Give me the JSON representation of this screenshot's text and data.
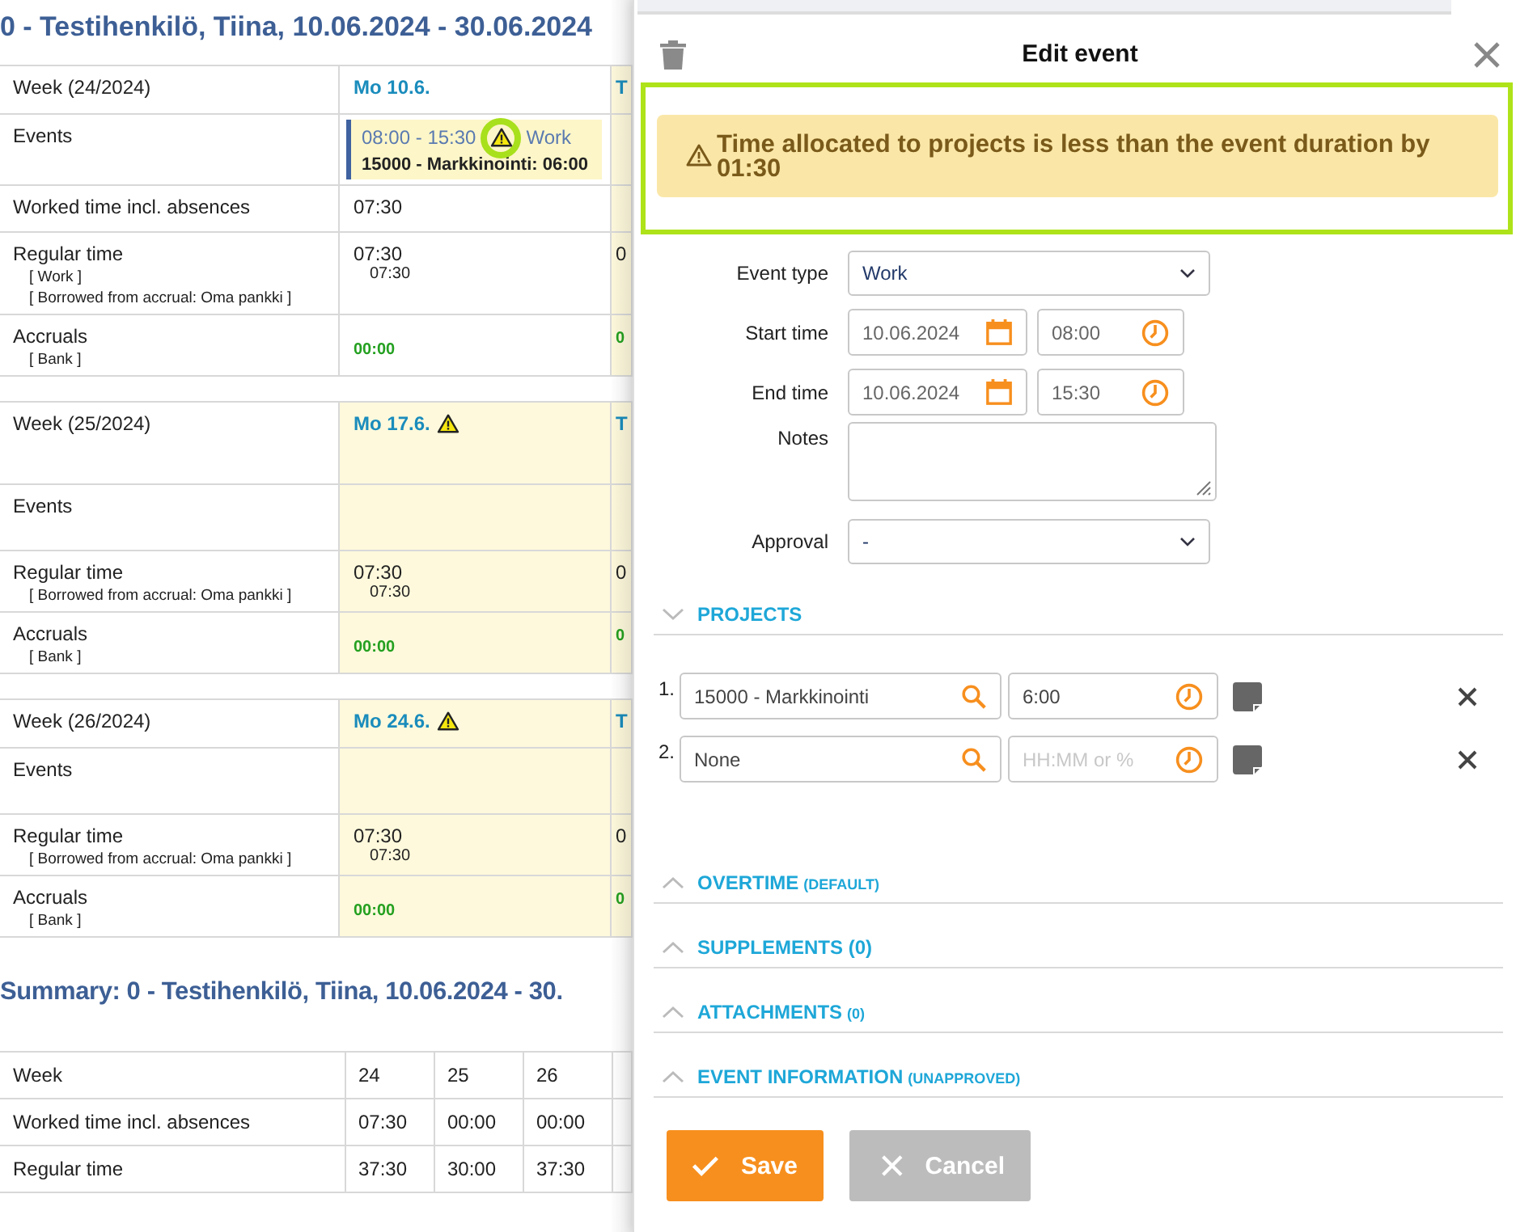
{
  "report_title": "0 - Testihenkilö, Tiina, 10.06.2024 - 30.06.2024",
  "weeks": [
    {
      "week_label": "Week",
      "week_number": "(24/2024)",
      "day": {
        "label": "Mo 10.6.",
        "warning": false,
        "highlighted": false
      },
      "next_day": {
        "label": "T",
        "highlighted": true
      },
      "rows": [
        {
          "kind": "events",
          "label": "Events",
          "event": {
            "time": "08:00 - 15:30",
            "type": "Work",
            "project": "15000 - Markkinointi: 06:00",
            "warning": true,
            "marked": true
          }
        },
        {
          "kind": "time",
          "label": "Worked time incl. absences",
          "value": "07:30"
        },
        {
          "kind": "time",
          "label": "Regular time",
          "details": [
            "[ Work ]",
            "[ Borrowed from accrual: Oma pankki ]"
          ],
          "value": "07:30",
          "sub_value": "07:30",
          "next_value": "0"
        },
        {
          "kind": "accrual",
          "label": "Accruals",
          "details": [
            "[ Bank ]"
          ],
          "value": "00:00",
          "next_value": "0"
        }
      ]
    },
    {
      "week_label": "Week",
      "week_number": "(25/2024)",
      "day": {
        "label": "Mo 17.6.",
        "warning": true,
        "highlighted": true
      },
      "next_day": {
        "label": "T",
        "highlighted": true
      },
      "rows": [
        {
          "kind": "events",
          "label": "Events"
        },
        {
          "kind": "time",
          "label": "Regular time",
          "details": [
            "[ Borrowed from accrual: Oma pankki ]"
          ],
          "value": "07:30",
          "sub_value": "07:30",
          "next_value": "0"
        },
        {
          "kind": "accrual",
          "label": "Accruals",
          "details": [
            "[ Bank ]"
          ],
          "value": "00:00",
          "next_value": "0"
        }
      ]
    },
    {
      "week_label": "Week",
      "week_number": "(26/2024)",
      "day": {
        "label": "Mo 24.6.",
        "warning": true,
        "highlighted": true
      },
      "next_day": {
        "label": "T",
        "highlighted": true
      },
      "rows": [
        {
          "kind": "events",
          "label": "Events"
        },
        {
          "kind": "time",
          "label": "Regular time",
          "details": [
            "[ Borrowed from accrual: Oma pankki ]"
          ],
          "value": "07:30",
          "sub_value": "07:30",
          "next_value": "0"
        },
        {
          "kind": "accrual",
          "label": "Accruals",
          "details": [
            "[ Bank ]"
          ],
          "value": "00:00",
          "next_value": "0"
        }
      ]
    }
  ],
  "summary": {
    "title": "Summary: 0 - Testihenkilö, Tiina, 10.06.2024 - 30.",
    "rows": [
      [
        "Week",
        "24",
        "25",
        "26"
      ],
      [
        "Worked time incl. absences",
        "07:30",
        "00:00",
        "00:00"
      ],
      [
        "Regular time",
        "37:30",
        "30:00",
        "37:30"
      ]
    ]
  },
  "dialog": {
    "title": "Edit event",
    "alert": {
      "text": "Time allocated to projects is less than the event duration by 01:30",
      "marked": true
    },
    "fields": [
      {
        "kind": "select",
        "label": "Event type",
        "value": "Work"
      },
      {
        "kind": "datetime",
        "label": "Start time",
        "date": "10.06.2024",
        "time": "08:00"
      },
      {
        "kind": "datetime",
        "label": "End time",
        "date": "10.06.2024",
        "time": "15:30"
      },
      {
        "kind": "textarea",
        "label": "Notes"
      },
      {
        "kind": "select",
        "label": "Approval",
        "value": "-"
      }
    ],
    "sections": [
      {
        "title": "PROJECTS",
        "expanded": true,
        "projects": [
          {
            "number": "1.",
            "project": "15000 - Markkinointi",
            "time": "6:00"
          },
          {
            "number": "2.",
            "project": "None",
            "time_placeholder": "HH:MM or %"
          }
        ]
      },
      {
        "title": "OVERTIME",
        "note": "(DEFAULT)",
        "expanded": false
      },
      {
        "title": "SUPPLEMENTS (0)",
        "expanded": false
      },
      {
        "title": "ATTACHMENTS",
        "note": "(0)",
        "expanded": false
      },
      {
        "title": "EVENT INFORMATION",
        "note": "(UNAPPROVED)",
        "expanded": false
      }
    ],
    "buttons": [
      {
        "kind": "save",
        "label": "Save",
        "disabled": false
      },
      {
        "kind": "cancel",
        "label": "Cancel",
        "disabled": true
      }
    ]
  }
}
